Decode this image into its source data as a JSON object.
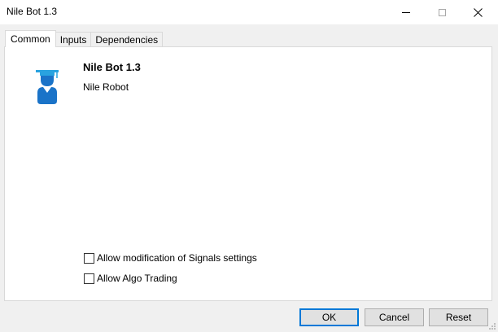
{
  "window": {
    "title": "Nile Bot 1.3"
  },
  "tabs": [
    {
      "label": "Common",
      "active": true
    },
    {
      "label": "Inputs",
      "active": false
    },
    {
      "label": "Dependencies",
      "active": false
    }
  ],
  "common": {
    "bot_name": "Nile Bot 1.3",
    "bot_description": "Nile Robot",
    "icon": "graduate-user-icon",
    "checkboxes": [
      {
        "label": "Allow modification of Signals settings",
        "checked": false
      },
      {
        "label": "Allow Algo Trading",
        "checked": false
      }
    ]
  },
  "buttons": {
    "ok": "OK",
    "cancel": "Cancel",
    "reset": "Reset"
  },
  "colors": {
    "icon_blue": "#1a73c8",
    "icon_cap": "#29a3e0",
    "ok_border": "#0078d7"
  }
}
